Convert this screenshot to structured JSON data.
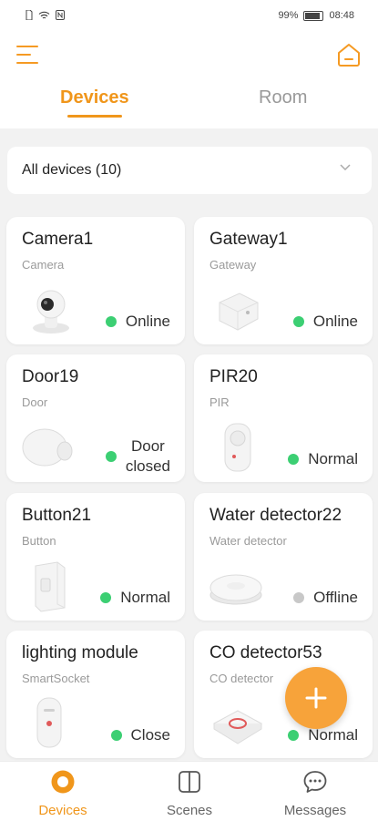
{
  "statusbar": {
    "battery": "99%",
    "time": "08:48"
  },
  "tabs": [
    {
      "label": "Devices"
    },
    {
      "label": "Room"
    }
  ],
  "filter": {
    "label": "All devices (10)"
  },
  "devices": [
    {
      "name": "Camera1",
      "type": "Camera",
      "status": "Online",
      "online": true,
      "icon": "camera-device-icon"
    },
    {
      "name": "Gateway1",
      "type": "Gateway",
      "status": "Online",
      "online": true,
      "icon": "gateway-device-icon"
    },
    {
      "name": "Door19",
      "type": "Door",
      "status_line1": "Door",
      "status_line2": "closed",
      "online": true,
      "icon": "door-sensor-icon"
    },
    {
      "name": "PIR20",
      "type": "PIR",
      "status": "Normal",
      "online": true,
      "icon": "pir-sensor-icon"
    },
    {
      "name": "Button21",
      "type": "Button",
      "status": "Normal",
      "online": true,
      "icon": "button-device-icon"
    },
    {
      "name": "Water detector22",
      "type": "Water detector",
      "status": "Offline",
      "online": false,
      "icon": "water-detector-icon"
    },
    {
      "name": "lighting module",
      "type": "SmartSocket",
      "status": "Close",
      "online": true,
      "icon": "smart-socket-icon"
    },
    {
      "name": "CO detector53",
      "type": "CO detector",
      "status": "Normal",
      "online": true,
      "icon": "co-detector-icon"
    }
  ],
  "bottom_nav": [
    {
      "label": "Devices",
      "active": true
    },
    {
      "label": "Scenes",
      "active": false
    },
    {
      "label": "Messages",
      "active": false
    }
  ],
  "colors": {
    "accent": "#f0961b",
    "online": "#3ccf73",
    "offline": "#c8c8c8",
    "fab": "#f7a33a"
  }
}
